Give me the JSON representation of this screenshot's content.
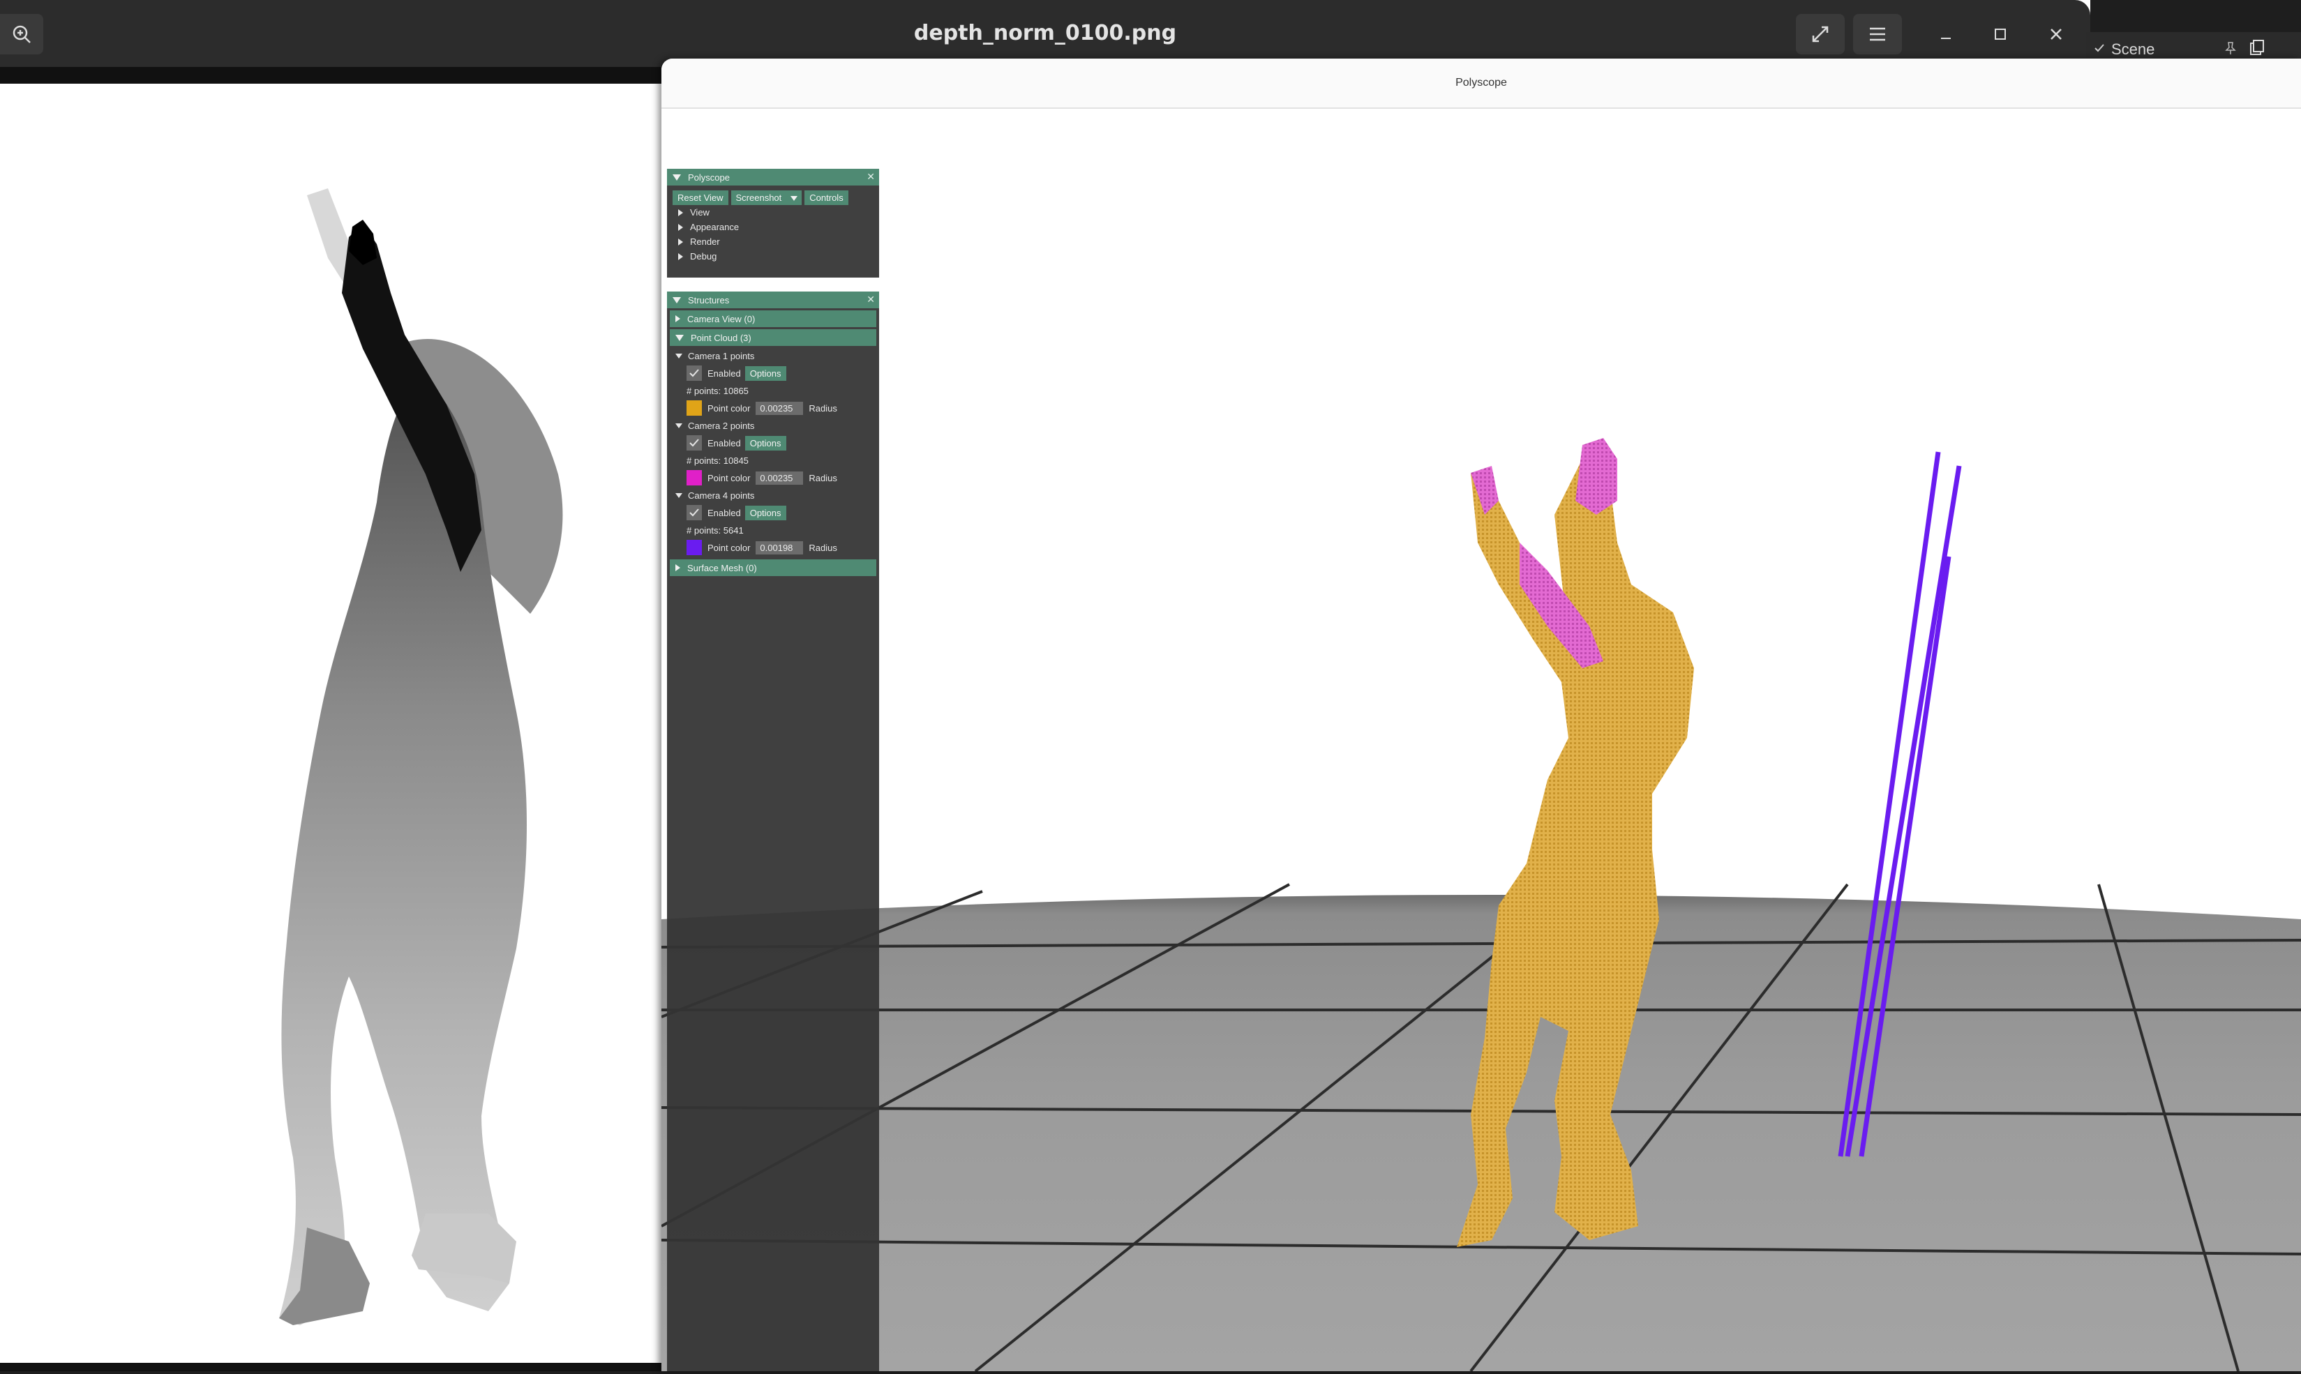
{
  "viewer": {
    "title": "depth_norm_0100.png"
  },
  "scene_peek": {
    "label": "Scene"
  },
  "polyscope_window": {
    "title": "Polyscope"
  },
  "polyscope_panel": {
    "title": "Polyscope",
    "buttons": {
      "reset_view": "Reset View",
      "screenshot": "Screenshot",
      "controls": "Controls"
    },
    "tree": [
      "View",
      "Appearance",
      "Render",
      "Debug"
    ]
  },
  "structures_panel": {
    "title": "Structures",
    "camera_view": "Camera View (0)",
    "point_cloud": "Point Cloud (3)",
    "surface_mesh": "Surface Mesh (0)",
    "clouds": [
      {
        "name": "Camera 1 points",
        "enabled_label": "Enabled",
        "options_label": "Options",
        "points": "# points: 10865",
        "color_label": "Point color",
        "radius_value": "0.00235",
        "radius_label": "Radius",
        "color": "#e0a418"
      },
      {
        "name": "Camera 2 points",
        "enabled_label": "Enabled",
        "options_label": "Options",
        "points": "# points: 10845",
        "color_label": "Point color",
        "radius_value": "0.00235",
        "radius_label": "Radius",
        "color": "#e020c8"
      },
      {
        "name": "Camera 4 points",
        "enabled_label": "Enabled",
        "options_label": "Options",
        "points": "# points: 5641",
        "color_label": "Point color",
        "radius_value": "0.00198",
        "radius_label": "Radius",
        "color": "#6a1cf0"
      }
    ]
  },
  "icons": {
    "zoom": "zoom-in-icon",
    "fullscreen": "fullscreen-icon",
    "menu": "hamburger-menu-icon",
    "minimize": "minimize-icon",
    "maximize": "maximize-icon",
    "close": "close-icon"
  }
}
